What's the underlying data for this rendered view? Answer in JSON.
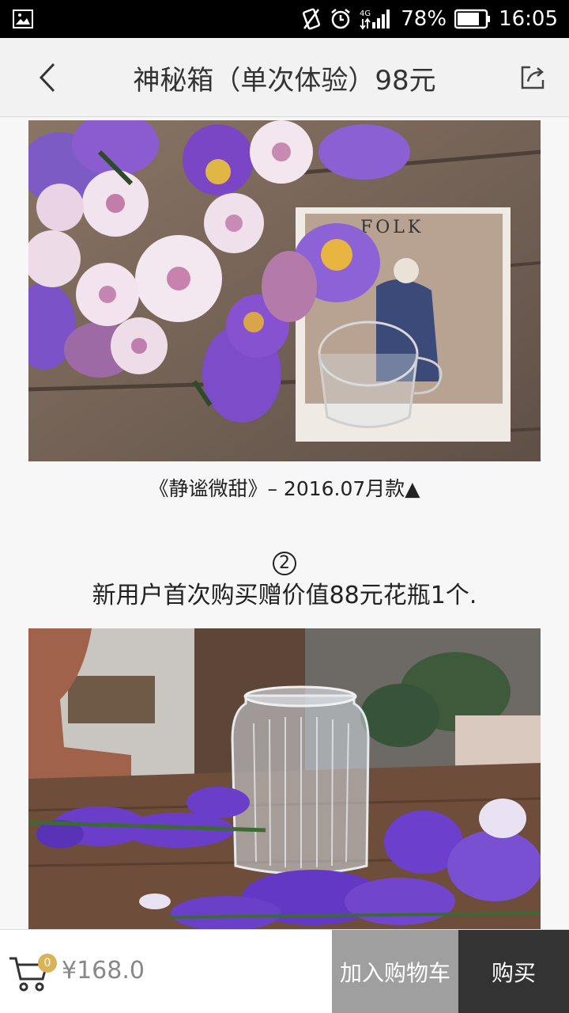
{
  "status_bar": {
    "battery": "78%",
    "time": "16:05",
    "network": "4G"
  },
  "header": {
    "title": "神秘箱（单次体验）98元",
    "back_icon": "chevron-left-icon",
    "share_icon": "share-icon"
  },
  "content": {
    "caption": "《静谧微甜》– 2016.07月款▲",
    "number_marker": "2",
    "promo_text": "新用户首次购买赠价值88元花瓶1个."
  },
  "bottom_bar": {
    "cart_count": "0",
    "price": "¥168.0",
    "add_to_cart_label": "加入购物车",
    "buy_label": "购买"
  },
  "colors": {
    "header_bg": "#f2f2f2",
    "badge": "#d9b25a",
    "add_to_cart_bg": "#9f9f9f",
    "buy_bg": "#333333"
  }
}
